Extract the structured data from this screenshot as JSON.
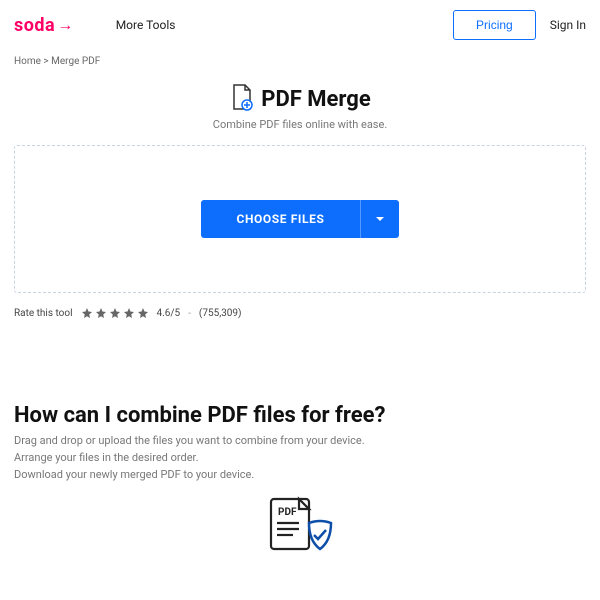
{
  "brand": {
    "name": "soda",
    "color": "#ff0066"
  },
  "nav": {
    "more_tools": "More Tools",
    "pricing": "Pricing",
    "sign_in": "Sign In"
  },
  "breadcrumb": {
    "home": "Home",
    "sep": ">",
    "page": "Merge PDF"
  },
  "hero": {
    "title": "PDF Merge",
    "subtitle": "Combine PDF files online with ease."
  },
  "dropzone": {
    "choose_label": "CHOOSE FILES"
  },
  "rating": {
    "label": "Rate this tool",
    "score": "4.6/5",
    "dash": "-",
    "count": "(755,309)"
  },
  "howto": {
    "heading": "How can I combine PDF files for free?",
    "line1": "Drag and drop or upload the files you want to combine from your device.",
    "line2": "Arrange your files in the desired order.",
    "line3": "Download your newly merged PDF to your device.",
    "badge": "PDF"
  }
}
